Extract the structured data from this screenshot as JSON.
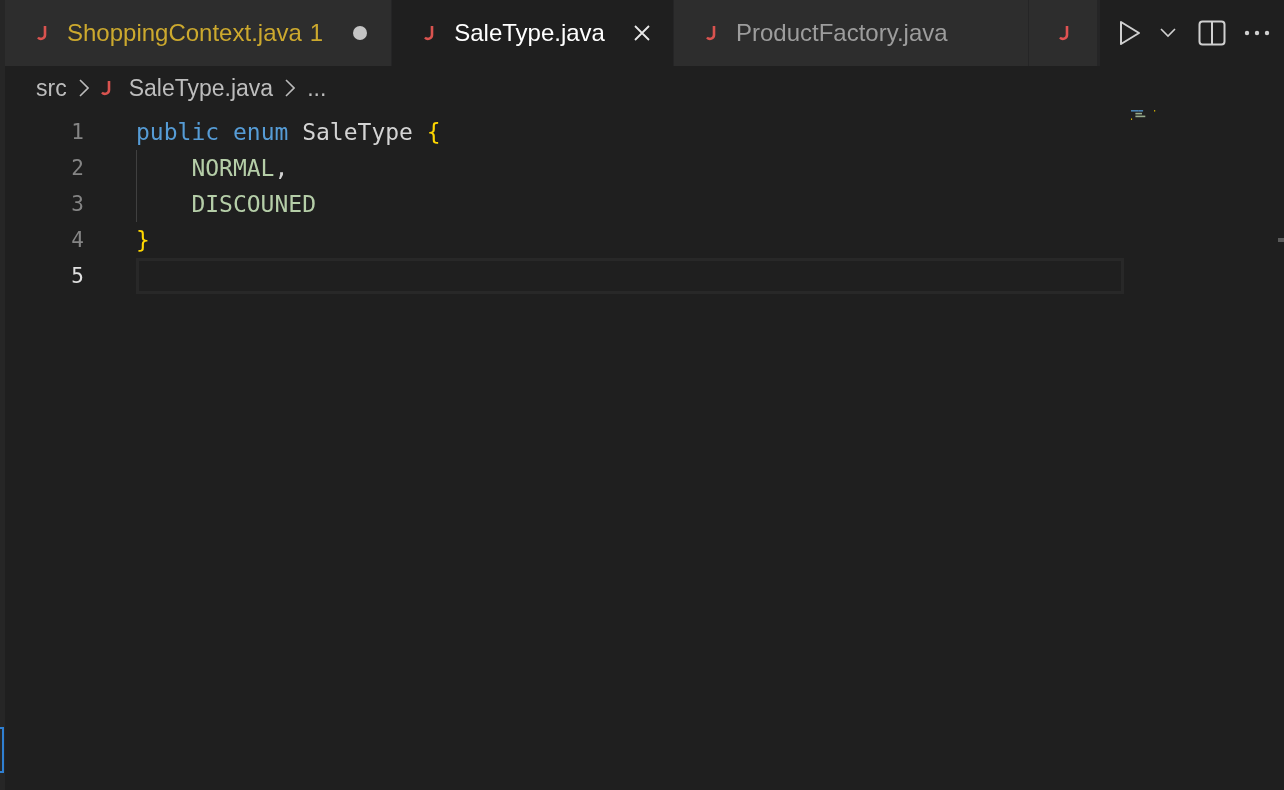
{
  "tabs": [
    {
      "kind": "file",
      "label": "ShoppingContext.java",
      "problems": "1",
      "selected": false,
      "modified": true
    },
    {
      "kind": "file",
      "label": "SaleType.java",
      "selected": true,
      "modified": false
    },
    {
      "kind": "file",
      "label": "ProductFactory.java",
      "selected": false,
      "modified": false
    },
    {
      "kind": "partial",
      "selected": false
    }
  ],
  "breadcrumb": [
    {
      "kind": "folder",
      "label": "src"
    },
    {
      "kind": "file",
      "label": "SaleType.java"
    },
    {
      "kind": "more",
      "label": "..."
    }
  ],
  "code": [
    {
      "number": "1",
      "current": false,
      "indent": false,
      "tokens": [
        {
          "kind": "keyword",
          "text": "public "
        },
        {
          "kind": "keyword",
          "text": "enum"
        },
        {
          "kind": "plain",
          "text": " SaleType "
        },
        {
          "kind": "brace",
          "text": "{"
        }
      ]
    },
    {
      "number": "2",
      "current": false,
      "indent": true,
      "tokens": [
        {
          "kind": "constant",
          "text": "NORMAL"
        },
        {
          "kind": "plain",
          "text": ","
        }
      ]
    },
    {
      "number": "3",
      "current": false,
      "indent": true,
      "tokens": [
        {
          "kind": "constant",
          "text": "DISCOUNED"
        }
      ]
    },
    {
      "number": "4",
      "current": false,
      "indent": false,
      "tokens": [
        {
          "kind": "brace",
          "text": "}"
        }
      ]
    },
    {
      "number": "5",
      "current": true
    }
  ]
}
